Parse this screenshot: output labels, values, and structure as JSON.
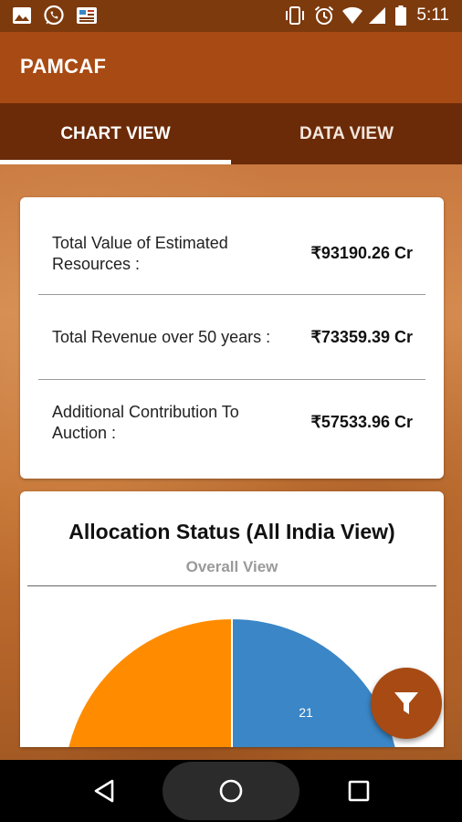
{
  "status_bar": {
    "time": "5:11",
    "left_icons": [
      "image-icon",
      "whatsapp-icon",
      "news-icon"
    ],
    "right_icons": [
      "vibrate-icon",
      "alarm-icon",
      "wifi-icon",
      "signal-icon",
      "battery-icon"
    ]
  },
  "app_bar": {
    "title": "PAMCAF"
  },
  "tabs": [
    {
      "label": "CHART VIEW",
      "selected": true
    },
    {
      "label": "DATA VIEW",
      "selected": false
    }
  ],
  "summary": {
    "rows": [
      {
        "label": "Total Value of Estimated Resources :",
        "value": "₹93190.26 Cr"
      },
      {
        "label": "Total Revenue over 50 years :",
        "value": "₹73359.39 Cr"
      },
      {
        "label": "Additional Contribution To Auction :",
        "value": "₹57533.96 Cr"
      }
    ]
  },
  "chart": {
    "title": "Allocation Status (All India View)",
    "subtitle": "Overall View"
  },
  "chart_data": {
    "type": "pie",
    "title": "Allocation Status (All India View)",
    "subtitle": "Overall View",
    "slices": [
      {
        "value": 21,
        "label": "21",
        "color": "#3a86c6"
      },
      {
        "value": null,
        "label": "",
        "color": "#ff8c00"
      }
    ]
  },
  "fab": {
    "icon": "filter-icon",
    "color": "#a84a13"
  },
  "nav_bar": {
    "icons": [
      "back-icon",
      "home-icon",
      "recents-icon"
    ]
  },
  "colors": {
    "app_bar": "#a84a13",
    "tab_bar": "#6b2a08",
    "status_bar": "#7d3a0d",
    "pie_blue": "#3a86c6",
    "pie_orange": "#ff8c00"
  }
}
